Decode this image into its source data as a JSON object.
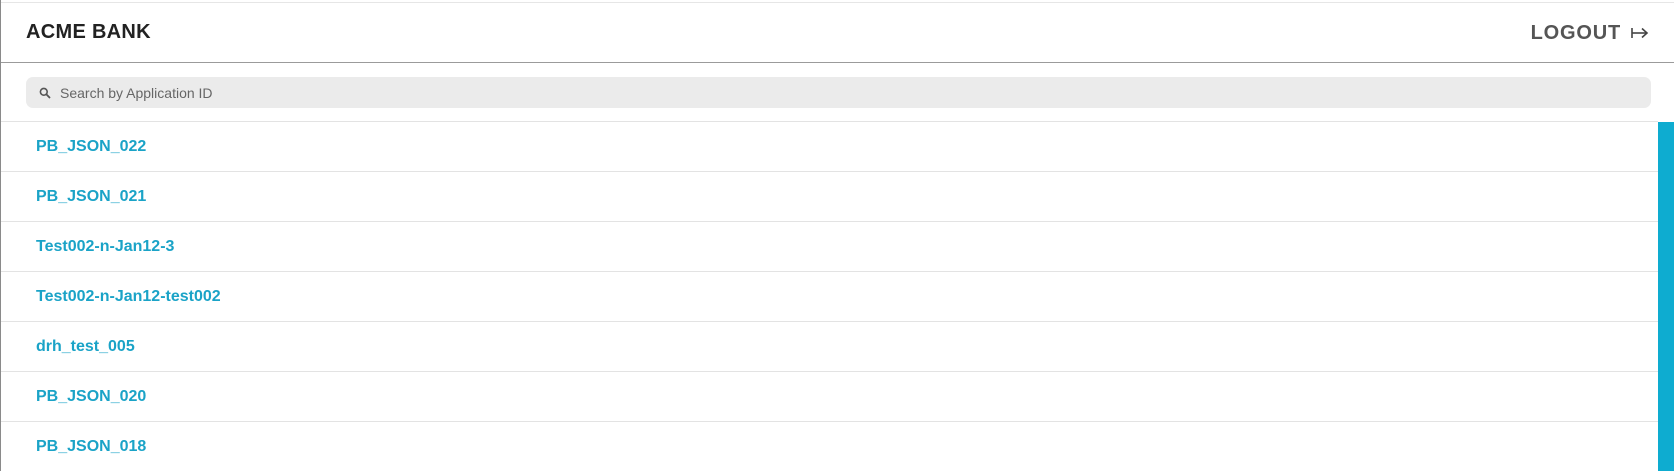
{
  "header": {
    "brand": "ACME BANK",
    "logout_label": "LOGOUT",
    "logout_icon": "→"
  },
  "search": {
    "placeholder": "Search by Application ID",
    "value": ""
  },
  "applications": [
    {
      "id": "PB_JSON_022"
    },
    {
      "id": "PB_JSON_021"
    },
    {
      "id": "Test002-n-Jan12-3"
    },
    {
      "id": "Test002-n-Jan12-test002"
    },
    {
      "id": "drh_test_005"
    },
    {
      "id": "PB_JSON_020"
    },
    {
      "id": "PB_JSON_018"
    }
  ],
  "colors": {
    "link": "#1aa3c7",
    "scrollbar": "#0eacd0",
    "search_bg": "#ebebeb"
  }
}
